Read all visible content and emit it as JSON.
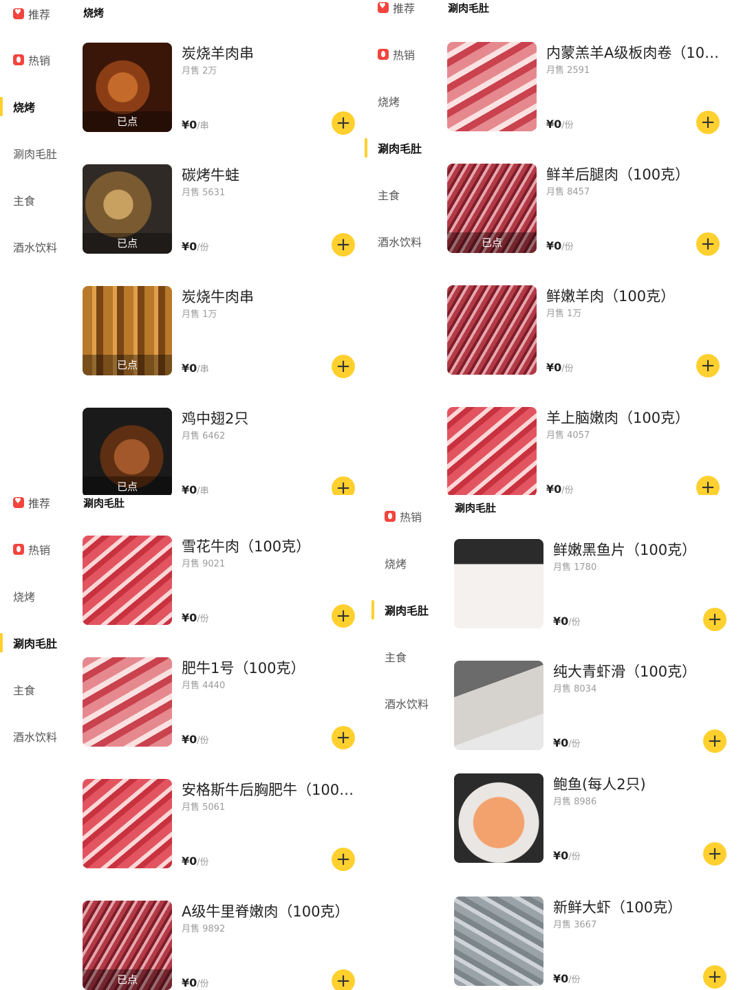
{
  "panels": {
    "p1": {
      "categories": [
        {
          "label": "推荐",
          "icon": "heart-icon"
        },
        {
          "label": "热销",
          "icon": "fire-icon"
        },
        {
          "label": "烧烤",
          "active": true
        },
        {
          "label": "涮肉毛肚"
        },
        {
          "label": "主食"
        },
        {
          "label": "酒水饮料"
        }
      ],
      "section_title": "烧烤",
      "items": [
        {
          "name": "炭烧羊肉串",
          "sales": "月售 2万",
          "price": "¥0",
          "unit": "/串",
          "badge": "已点"
        },
        {
          "name": "碳烤牛蛙",
          "sales": "月售 5631",
          "price": "¥0",
          "unit": "/份",
          "badge": "已点"
        },
        {
          "name": "炭烧牛肉串",
          "sales": "月售 1万",
          "price": "¥0",
          "unit": "/串",
          "badge": "已点"
        },
        {
          "name": "鸡中翅2只",
          "sales": "月售 6462",
          "price": "¥0",
          "unit": "/串",
          "badge": "已点"
        }
      ]
    },
    "p2": {
      "categories": [
        {
          "label": "推荐",
          "icon": "heart-icon"
        },
        {
          "label": "热销",
          "icon": "fire-icon"
        },
        {
          "label": "烧烤"
        },
        {
          "label": "涮肉毛肚",
          "active": true
        },
        {
          "label": "主食"
        },
        {
          "label": "酒水饮料"
        }
      ],
      "section_title": "涮肉毛肚",
      "items": [
        {
          "name": "内蒙羔羊A级板肉卷（10…",
          "sales": "月售 2591",
          "price": "¥0",
          "unit": "/份"
        },
        {
          "name": "鲜羊后腿肉（100克）",
          "sales": "月售 8457",
          "price": "¥0",
          "unit": "/份",
          "badge": "已点"
        },
        {
          "name": "鲜嫩羊肉（100克）",
          "sales": "月售 1万",
          "price": "¥0",
          "unit": "/份"
        },
        {
          "name": "羊上脑嫩肉（100克）",
          "sales": "月售 4057",
          "price": "¥0",
          "unit": "/份"
        }
      ]
    },
    "p3": {
      "categories": [
        {
          "label": "推荐",
          "icon": "heart-icon"
        },
        {
          "label": "热销",
          "icon": "fire-icon"
        },
        {
          "label": "烧烤"
        },
        {
          "label": "涮肉毛肚",
          "active": true
        },
        {
          "label": "主食"
        },
        {
          "label": "酒水饮料"
        }
      ],
      "section_title": "涮肉毛肚",
      "items": [
        {
          "name": "雪花牛肉（100克）",
          "sales": "月售 9021",
          "price": "¥0",
          "unit": "/份"
        },
        {
          "name": "肥牛1号（100克）",
          "sales": "月售 4440",
          "price": "¥0",
          "unit": "/份"
        },
        {
          "name": "安格斯牛后胸肥牛（100…",
          "sales": "月售 5061",
          "price": "¥0",
          "unit": "/份"
        },
        {
          "name": "A级牛里脊嫩肉（100克）",
          "sales": "月售 9892",
          "price": "¥0",
          "unit": "/份",
          "badge": "已点"
        }
      ]
    },
    "p4": {
      "categories": [
        {
          "label": "热销",
          "icon": "fire-icon"
        },
        {
          "label": "烧烤"
        },
        {
          "label": "涮肉毛肚",
          "active": true
        },
        {
          "label": "主食"
        },
        {
          "label": "酒水饮料"
        }
      ],
      "section_title": "涮肉毛肚",
      "items": [
        {
          "name": "鲜嫩黑鱼片（100克）",
          "sales": "月售 1780",
          "price": "¥0",
          "unit": "/份"
        },
        {
          "name": "纯大青虾滑（100克）",
          "sales": "月售 8034",
          "price": "¥0",
          "unit": "/份"
        },
        {
          "name": "鲍鱼(每人2只)",
          "sales": "月售 8986",
          "price": "¥0",
          "unit": "/份"
        },
        {
          "name": "新鲜大虾（100克）",
          "sales": "月售 3667",
          "price": "¥0",
          "unit": "/份"
        }
      ]
    }
  }
}
